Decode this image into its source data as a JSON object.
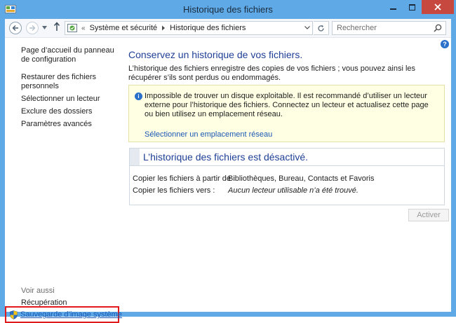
{
  "window": {
    "title": "Historique des fichiers"
  },
  "navbar": {
    "breadcrumb_prefix": "«",
    "breadcrumb": [
      "Système et sécurité",
      "Historique des fichiers"
    ],
    "search_placeholder": "Rechercher"
  },
  "help": {
    "label": "?"
  },
  "sidebar": {
    "items": [
      {
        "label": "Page d’accueil du panneau de configuration"
      },
      {
        "label": "Restaurer des fichiers personnels"
      },
      {
        "label": "Sélectionner un lecteur"
      },
      {
        "label": "Exclure des dossiers"
      },
      {
        "label": "Paramètres avancés"
      }
    ],
    "see_also": "Voir aussi",
    "recovery": "Récupération",
    "system_image_backup": "Sauvegarde d’image système"
  },
  "main": {
    "heading": "Conservez un historique de vos fichiers.",
    "description": "L’historique des fichiers enregistre des copies de vos fichiers ; vous pouvez ainsi les récupérer s’ils sont perdus ou endommagés.",
    "warning": {
      "text": "Impossible de trouver un disque exploitable. Il est recommandé d’utiliser un lecteur externe pour l’historique des fichiers. Connectez un lecteur et actualisez cette page ou bien utilisez un emplacement réseau.",
      "link": "Sélectionner un emplacement réseau"
    },
    "status": {
      "title": "L’historique des fichiers est désactivé.",
      "rows": [
        {
          "label": "Copier les fichiers à partir de :",
          "value": "Bibliothèques, Bureau, Contacts et Favoris"
        },
        {
          "label": "Copier les fichiers vers :",
          "value": "Aucun lecteur utilisable n’a été trouvé."
        }
      ]
    },
    "activate_button": "Activer"
  }
}
